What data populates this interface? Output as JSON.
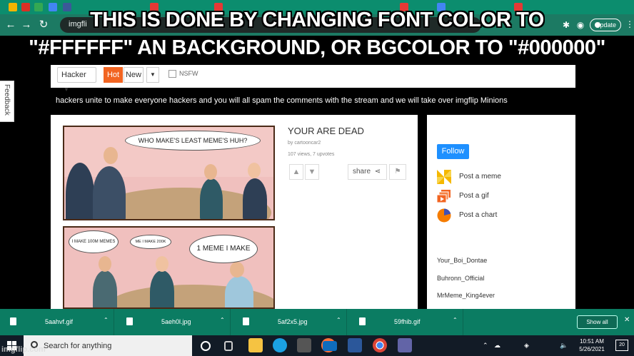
{
  "meme_caption": {
    "line1": "THIS IS DONE BY CHANGING FONT COLOR TO",
    "line2": "\"#FFFFFF\" AN BACKGROUND, OR BGCOLOR TO \"#000000\""
  },
  "browser": {
    "url_fragment": "imgfli",
    "update_label": "Update",
    "accent_color": "#0c8d6e"
  },
  "subnav": {
    "stream_select": "Hacker",
    "hot_label": "Hot",
    "new_label": "New",
    "nsfw_label": "NSFW"
  },
  "feedback_label": "Feedback",
  "stream_description": "hackers unite to make everyone hackers and you will all spam the comments with the stream and we will take over imgflip Minions",
  "post": {
    "title": "YOUR ARE DEAD",
    "author": "by cartooncar2",
    "stats": "107 views, 7 upvotes",
    "share_label": "share",
    "panel1_bubble": "WHO MAKE'S LEAST MEME'S HUH?",
    "panel2_bubble1": "I MAKE 100M MEMES",
    "panel2_bubble2": "ME I MAKE 200K",
    "panel2_bubble3": "1 MEME I MAKE"
  },
  "sidebar": {
    "follow_label": "Follow",
    "items": [
      {
        "label": "Post a meme",
        "icon": "pinwheel-icon"
      },
      {
        "label": "Post a gif",
        "icon": "gif-stack-icon"
      },
      {
        "label": "Post a chart",
        "icon": "pie-chart-icon"
      }
    ],
    "users": [
      "Your_Boi_Dontae",
      "Buhronn_Official",
      "MrMeme_King4ever"
    ]
  },
  "downloads": {
    "files": [
      "5aahvf.gif",
      "5aeh0l.jpg",
      "5af2x5.jpg",
      "59fhib.gif"
    ],
    "show_all_label": "Show all"
  },
  "taskbar": {
    "search_placeholder": "Search for anything",
    "time": "10:51 AM",
    "date": "5/26/2021",
    "notification_count": "20",
    "watermark": "imgflip.com"
  }
}
